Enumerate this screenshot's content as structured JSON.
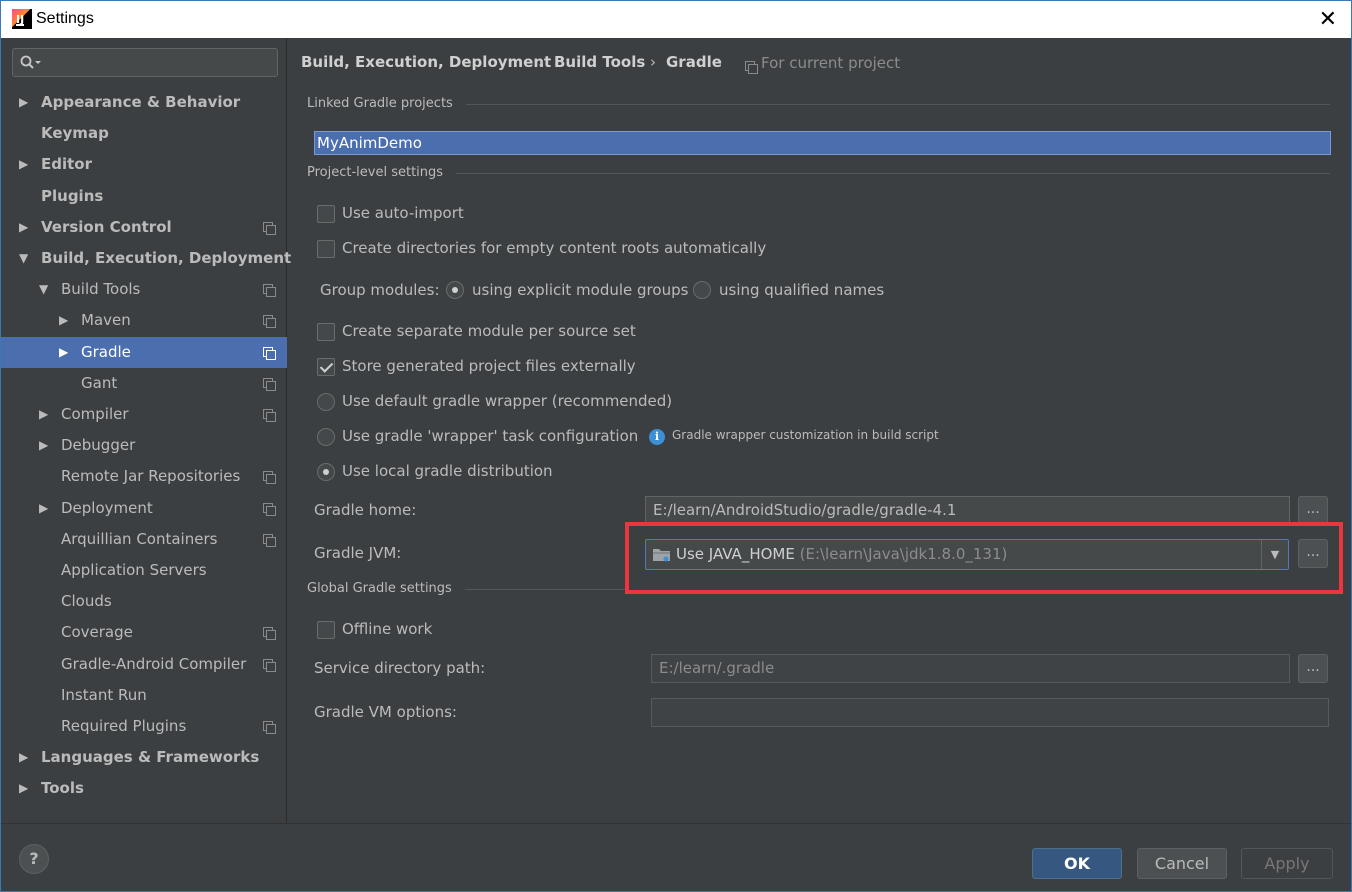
{
  "window": {
    "title": "Settings",
    "close_glyph": "✕"
  },
  "search": {
    "placeholder": "",
    "value": ""
  },
  "sidebar": {
    "items": [
      {
        "label": "Appearance & Behavior",
        "level": 0,
        "arrow": "right",
        "bold": true,
        "project": false
      },
      {
        "label": "Keymap",
        "level": 0,
        "arrow": "",
        "bold": true,
        "project": false
      },
      {
        "label": "Editor",
        "level": 0,
        "arrow": "right",
        "bold": true,
        "project": false
      },
      {
        "label": "Plugins",
        "level": 0,
        "arrow": "",
        "bold": true,
        "project": false
      },
      {
        "label": "Version Control",
        "level": 0,
        "arrow": "right",
        "bold": true,
        "project": true
      },
      {
        "label": "Build, Execution, Deployment",
        "level": 0,
        "arrow": "down",
        "bold": true,
        "project": false
      },
      {
        "label": "Build Tools",
        "level": 1,
        "arrow": "down",
        "bold": false,
        "project": true
      },
      {
        "label": "Maven",
        "level": 2,
        "arrow": "right",
        "bold": false,
        "project": true
      },
      {
        "label": "Gradle",
        "level": 2,
        "arrow": "right",
        "bold": false,
        "project": true,
        "selected": true
      },
      {
        "label": "Gant",
        "level": 2,
        "arrow": "",
        "bold": false,
        "project": true
      },
      {
        "label": "Compiler",
        "level": 1,
        "arrow": "right",
        "bold": false,
        "project": true
      },
      {
        "label": "Debugger",
        "level": 1,
        "arrow": "right",
        "bold": false,
        "project": false
      },
      {
        "label": "Remote Jar Repositories",
        "level": 1,
        "arrow": "",
        "bold": false,
        "project": true
      },
      {
        "label": "Deployment",
        "level": 1,
        "arrow": "right",
        "bold": false,
        "project": true
      },
      {
        "label": "Arquillian Containers",
        "level": 1,
        "arrow": "",
        "bold": false,
        "project": true
      },
      {
        "label": "Application Servers",
        "level": 1,
        "arrow": "",
        "bold": false,
        "project": false
      },
      {
        "label": "Clouds",
        "level": 1,
        "arrow": "",
        "bold": false,
        "project": false
      },
      {
        "label": "Coverage",
        "level": 1,
        "arrow": "",
        "bold": false,
        "project": true
      },
      {
        "label": "Gradle-Android Compiler",
        "level": 1,
        "arrow": "",
        "bold": false,
        "project": true
      },
      {
        "label": "Instant Run",
        "level": 1,
        "arrow": "",
        "bold": false,
        "project": false
      },
      {
        "label": "Required Plugins",
        "level": 1,
        "arrow": "",
        "bold": false,
        "project": true
      },
      {
        "label": "Languages & Frameworks",
        "level": 0,
        "arrow": "right",
        "bold": true,
        "project": false
      },
      {
        "label": "Tools",
        "level": 0,
        "arrow": "right",
        "bold": true,
        "project": false
      }
    ]
  },
  "breadcrumb": {
    "items": [
      "Build, Execution, Deployment",
      "Build Tools",
      "Gradle"
    ],
    "separator": "›",
    "scope": "For current project"
  },
  "linked": {
    "section": "Linked Gradle projects",
    "project": "MyAnimDemo"
  },
  "project_level": {
    "section": "Project-level settings",
    "auto_import": "Use auto-import",
    "create_dirs": "Create directories for empty content roots automatically",
    "group_modules_label": "Group modules:",
    "group_explicit": "using explicit module groups",
    "group_qualified": "using qualified names",
    "separate_module": "Create separate module per source set",
    "store_external": "Store generated project files externally",
    "default_wrapper": "Use default gradle wrapper (recommended)",
    "wrapper_task": "Use gradle 'wrapper' task configuration",
    "wrapper_hint": "Gradle wrapper customization in build script",
    "local_dist": "Use local gradle distribution",
    "gradle_home_label": "Gradle home:",
    "gradle_home_value": "E:/learn/AndroidStudio/gradle/gradle-4.1",
    "gradle_jvm_label": "Gradle JVM:",
    "gradle_jvm_value": "Use JAVA_HOME",
    "gradle_jvm_path": "(E:\\learn\\Java\\jdk1.8.0_131)"
  },
  "global": {
    "section": "Global Gradle settings",
    "offline": "Offline work",
    "service_dir_label": "Service directory path:",
    "service_dir_value": "E:/learn/.gradle",
    "vm_options_label": "Gradle VM options:",
    "vm_options_value": ""
  },
  "browse_label": "...",
  "dropdown_glyph": "▼",
  "buttons": {
    "ok": "OK",
    "cancel": "Cancel",
    "apply": "Apply",
    "help": "?"
  },
  "colors": {
    "selection": "#4b6eaf",
    "highlight_box": "#e8383d",
    "background": "#3c3f41"
  }
}
